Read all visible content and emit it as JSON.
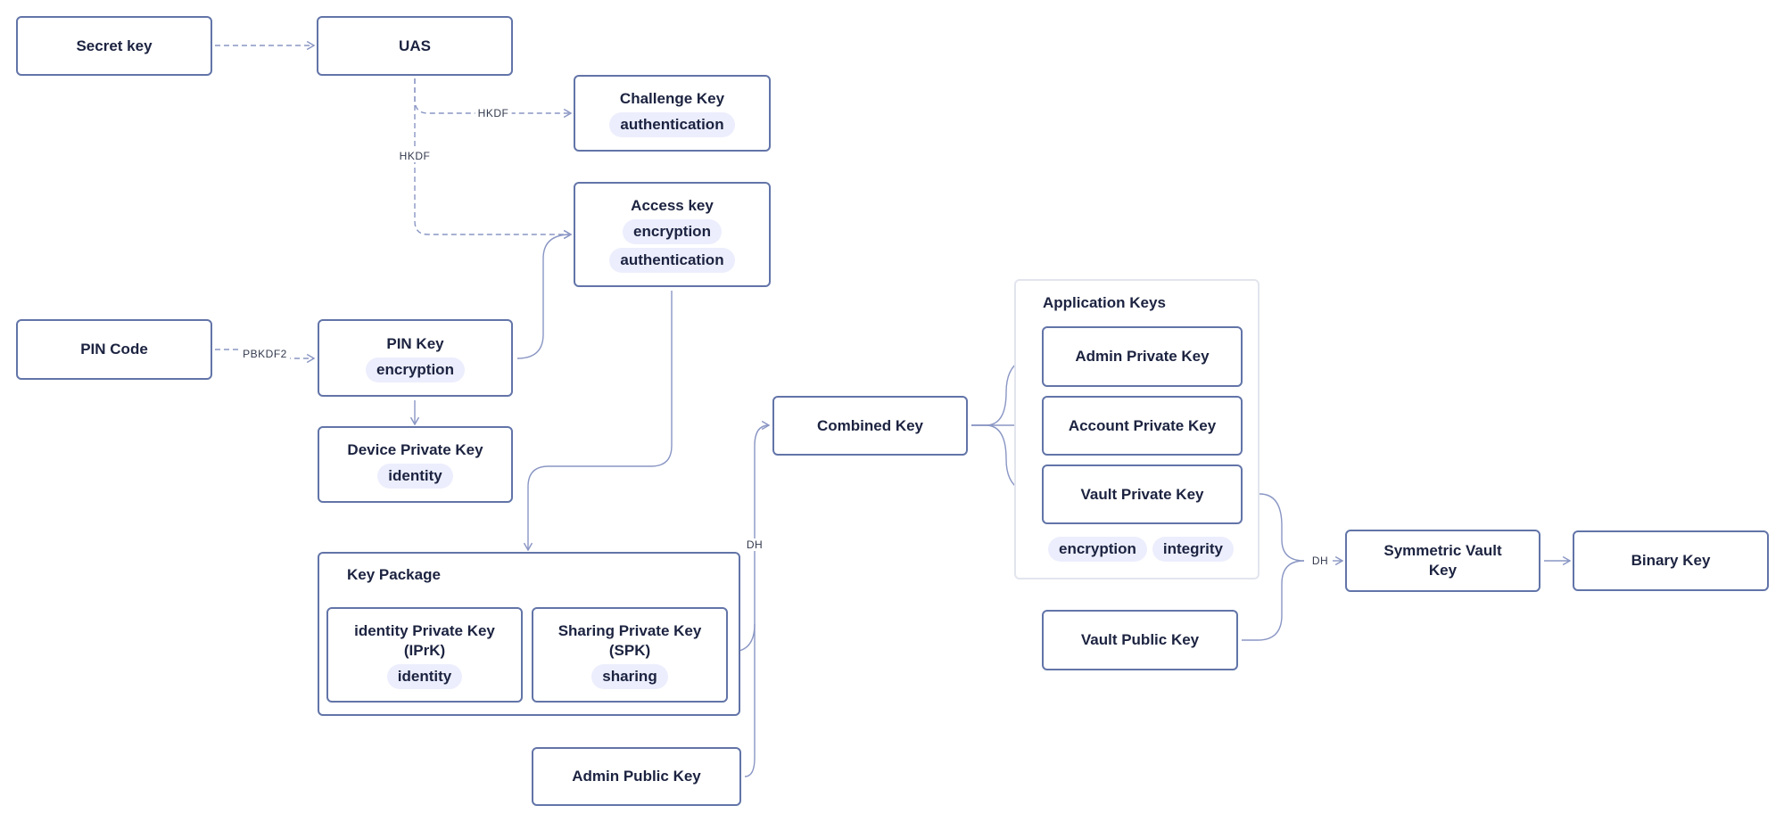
{
  "nodes": {
    "secret_key": {
      "title": "Secret key"
    },
    "uas": {
      "title": "UAS"
    },
    "challenge_key": {
      "title": "Challenge Key",
      "tags": [
        "authentication"
      ]
    },
    "access_key": {
      "title": "Access key",
      "tags": [
        "encryption",
        "authentication"
      ]
    },
    "pin_code": {
      "title": "PIN Code"
    },
    "pin_key": {
      "title": "PIN Key",
      "tags": [
        "encryption"
      ]
    },
    "device_private_key": {
      "title": "Device Private Key",
      "tags": [
        "identity"
      ]
    },
    "key_package": {
      "title": "Key Package",
      "iprk": {
        "title": "identity Private Key (IPrK)",
        "tags": [
          "identity"
        ]
      },
      "spk": {
        "title": "Sharing Private Key (SPK)",
        "tags": [
          "sharing"
        ]
      }
    },
    "admin_public_key": {
      "title": "Admin Public Key"
    },
    "combined_key": {
      "title": "Combined Key"
    },
    "application_keys": {
      "title": "Application Keys",
      "admin_private_key": {
        "title": "Admin Private Key"
      },
      "account_private_key": {
        "title": "Account Private Key"
      },
      "vault_private_key": {
        "title": "Vault Private Key"
      },
      "tags": [
        "encryption",
        "integrity"
      ]
    },
    "vault_public_key": {
      "title": "Vault Public Key"
    },
    "symmetric_vault_key": {
      "title": "Symmetric Vault Key"
    },
    "binary_key": {
      "title": "Binary Key"
    }
  },
  "edge_labels": {
    "hkdf_challenge": "HKDF",
    "hkdf_access": "HKDF",
    "pbkdf2": "PBKDF2",
    "dh_combined": "DH",
    "dh_symmetric": "DH"
  },
  "colors": {
    "node_border": "#6274a8",
    "edge": "#8a96c4",
    "tag_bg": "#eceefd",
    "text": "#1c2340",
    "group_border_light": "#e2e5ee"
  }
}
